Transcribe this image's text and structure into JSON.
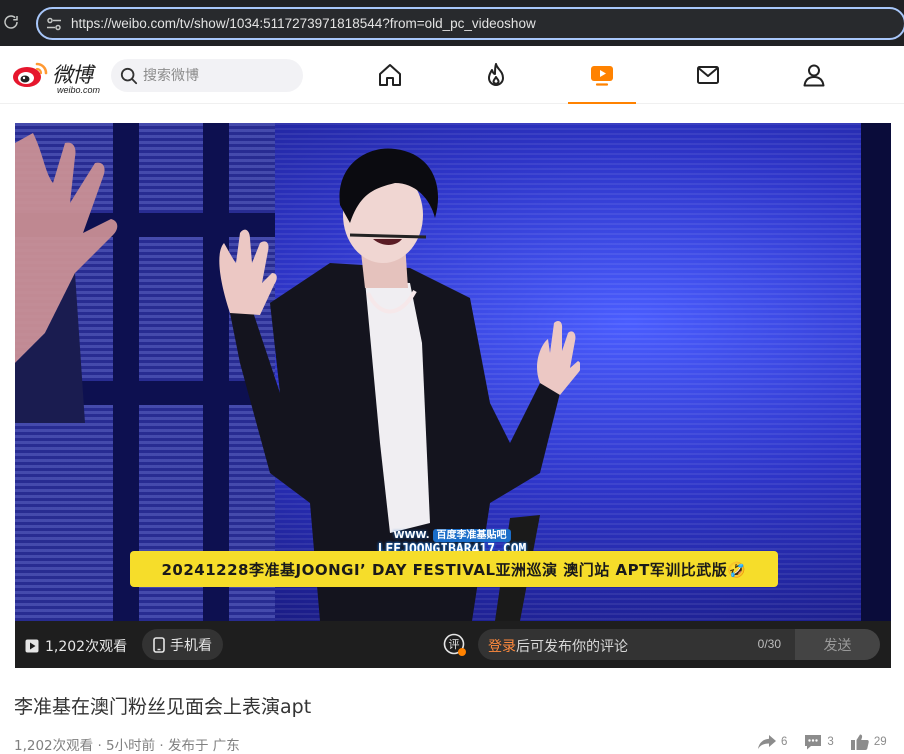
{
  "browser": {
    "url": "https://weibo.com/tv/show/1034:5117273971818544?from=old_pc_videoshow"
  },
  "header": {
    "logo_text": "微博",
    "logo_sub": "weibo.com",
    "search_placeholder": "搜索微博",
    "nav": [
      {
        "name": "home",
        "icon": "home-icon"
      },
      {
        "name": "hot",
        "icon": "fire-icon"
      },
      {
        "name": "video",
        "icon": "tv-play-icon",
        "active": true
      },
      {
        "name": "messages",
        "icon": "mail-icon"
      },
      {
        "name": "profile",
        "icon": "user-icon"
      }
    ]
  },
  "video": {
    "subtitle": "20241228李准基JOONGI’ DAY FESTIVAL亚洲巡演 澳门站 APT军训比武版🤣",
    "watermark_top": "百度李准基贴吧",
    "watermark_main": "LEEJOONGIBAR417.COM",
    "watermark_www": "WWW."
  },
  "video_bar": {
    "views": "1,202次观看",
    "phone_watch": "手机看",
    "comment_badge": "评",
    "comment_login": "登录",
    "comment_hint": "后可发布你的评论",
    "comment_count": "0/30",
    "send": "发送"
  },
  "post": {
    "title": "李准基在澳门粉丝见面会上表演apt",
    "meta": "1,202次观看 · 5小时前 · 发布于 广东",
    "shares": "6",
    "comments": "3",
    "likes": "29"
  },
  "colors": {
    "accent": "#ff8200",
    "subtitle_bg": "#f6dd2a",
    "login_link": "#ff8a3d"
  }
}
